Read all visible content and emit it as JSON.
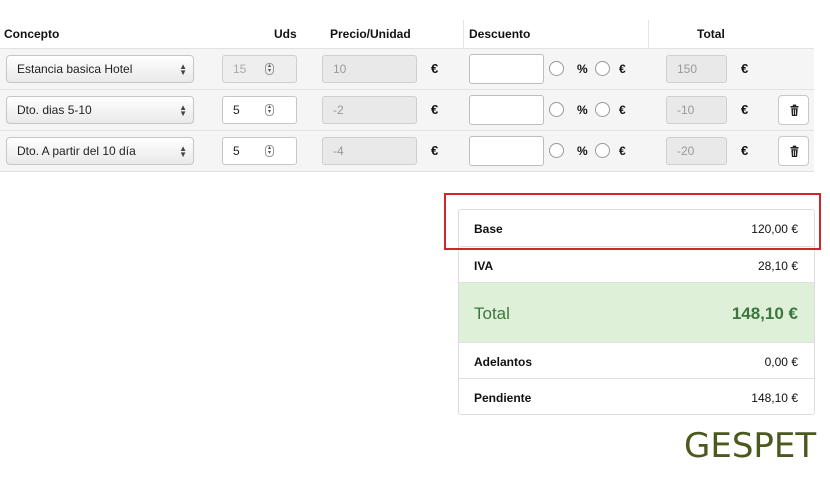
{
  "headers": {
    "concepto": "Concepto",
    "uds": "Uds",
    "precio_unidad": "Precio/Unidad",
    "descuento": "Descuento",
    "total": "Total"
  },
  "rows": [
    {
      "concepto": "Estancia basica Hotel",
      "uds": "15",
      "precio": "10",
      "euro": "€",
      "pct": "%",
      "eur_opt": "€",
      "total": "150",
      "deletable": false
    },
    {
      "concepto": "Dto. dias 5-10",
      "uds": "5",
      "precio": "-2",
      "euro": "€",
      "pct": "%",
      "eur_opt": "€",
      "total": "-10",
      "deletable": true
    },
    {
      "concepto": "Dto. A partir del 10 día",
      "uds": "5",
      "precio": "-4",
      "euro": "€",
      "pct": "%",
      "eur_opt": "€",
      "total": "-20",
      "deletable": true
    }
  ],
  "summary": {
    "base_label": "Base",
    "base_value": "120,00 €",
    "iva_label": "IVA",
    "iva_value": "28,10 €",
    "total_label": "Total",
    "total_value": "148,10 €",
    "adelantos_label": "Adelantos",
    "adelantos_value": "0,00 €",
    "pendiente_label": "Pendiente",
    "pendiente_value": "148,10 €"
  },
  "logo": "GESPET",
  "colors": {
    "highlight": "#d0252a",
    "total_bg": "#dff0d8",
    "total_text": "#3c763d",
    "logo": "#4a5a1e"
  },
  "icons": {
    "select_arrows": "up-down-arrows-icon",
    "spinner": "spinner-icon",
    "trash": "trash-icon"
  }
}
